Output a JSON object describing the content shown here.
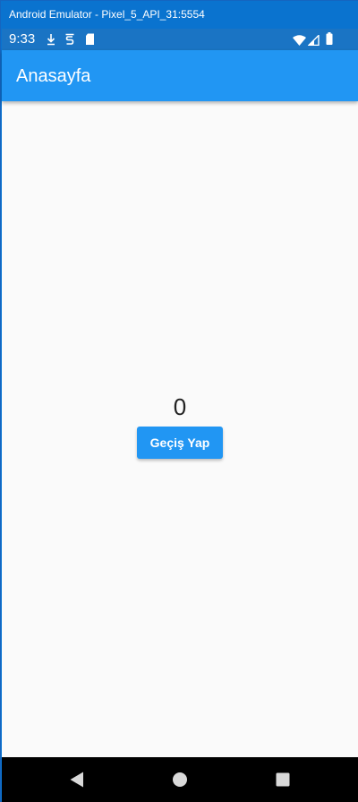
{
  "window": {
    "title": "Android Emulator - Pixel_5_API_31:5554"
  },
  "status_bar": {
    "time": "9:33",
    "icons": [
      "download-notification-icon",
      "s-notification-icon",
      "sd-card-icon",
      "wifi-icon",
      "signal-icon",
      "battery-icon"
    ]
  },
  "app_bar": {
    "title": "Anasayfa"
  },
  "main": {
    "counter": "0",
    "button_label": "Geçiş Yap"
  },
  "nav_bar": {
    "keys": [
      "back-icon",
      "home-icon",
      "recents-icon"
    ]
  },
  "colors": {
    "title_bar": "#0a73cf",
    "status_bar": "#1a74c4",
    "primary": "#2196f3",
    "background": "#fafafa",
    "nav_bar": "#000000"
  }
}
